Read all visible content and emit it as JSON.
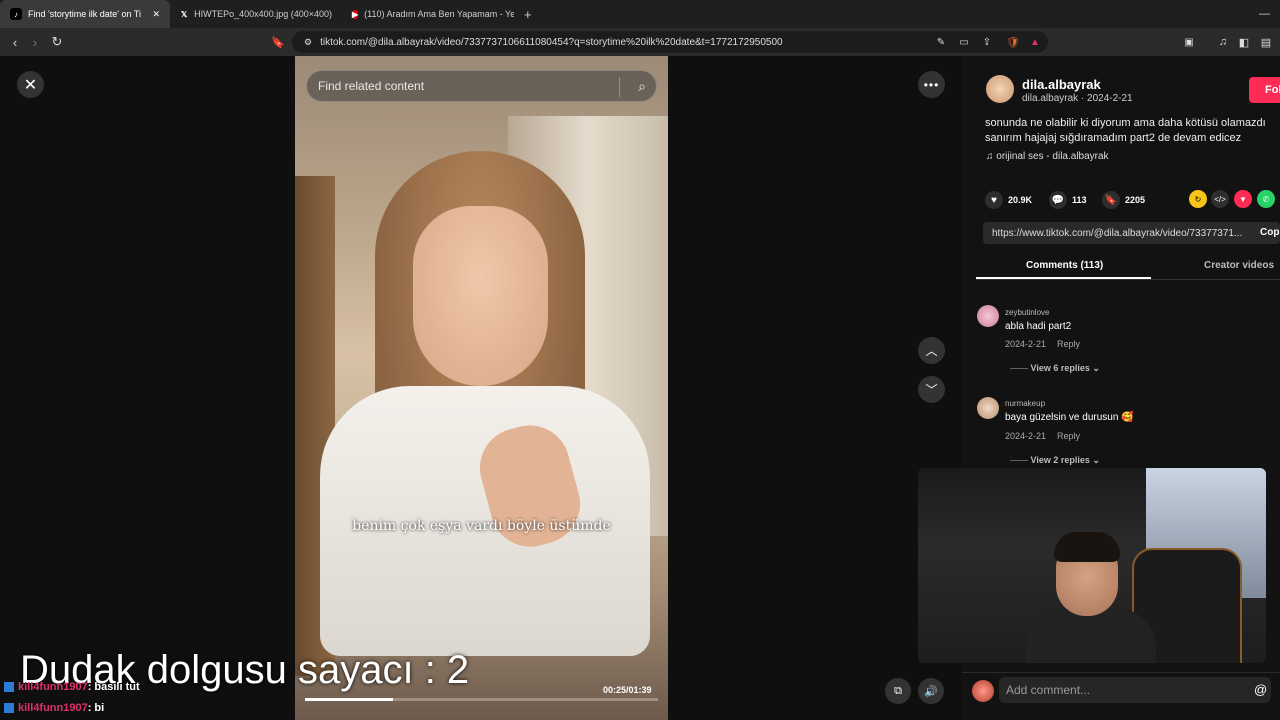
{
  "tabs": [
    {
      "title": "Find 'storytime ilk date' on Ti",
      "active": true
    },
    {
      "title": "HIWTEPo_400x400.jpg (400×400)",
      "active": false
    },
    {
      "title": "(110) Aradım Ama Ben Yapamam - Ye",
      "active": false
    }
  ],
  "toolbar": {
    "url": "tiktok.com/@dila.albayrak/video/7337737106611080454?q=storytime%20ilk%20date&t=1772172950500"
  },
  "player": {
    "search_placeholder": "Find related content",
    "caption": "benim çok eşya vardı böyle üstümde",
    "timecode": "00:25/01:39",
    "progress": 0.25
  },
  "overlay": {
    "title": "Dudak dolgusu  sayacı : 2",
    "chat": [
      {
        "user": "kill4funn1907",
        "message": ": basılı tut"
      },
      {
        "user": "kill4funn1907",
        "message": ": bi"
      }
    ]
  },
  "panel": {
    "username": "dila.albayrak",
    "subline": "dila.albayrak · 2024-2-21",
    "follow_label": "Fol",
    "description_line1": "sonunda ne olabilir ki diyorum ama daha kötüsü olamazdı",
    "description_line2": "sanırım hajajaj sığdıramadım part2 de devam edicez",
    "sound": "orijinal ses - dila.albayrak",
    "likes": "20.9K",
    "comments": "113",
    "saves": "2205",
    "link": "https://www.tiktok.com/@dila.albayrak/video/73377371...",
    "copy_label": "Cop",
    "tab_comments": "Comments (113)",
    "tab_creator": "Creator videos"
  },
  "comments": [
    {
      "user": "zeybutinlove",
      "text": "abla hadi part2",
      "date": "2024-2-21",
      "reply": "Reply",
      "replies": "View 6 replies"
    },
    {
      "user": "nurmakeup",
      "text": "baya güzelsin ve durusun 🥰",
      "date": "2024-2-21",
      "reply": "Reply",
      "replies": "View 2 replies"
    }
  ],
  "comment_bar": {
    "placeholder": "Add comment..."
  },
  "colors": {
    "accent": "#fe2c55",
    "background": "#121212"
  }
}
